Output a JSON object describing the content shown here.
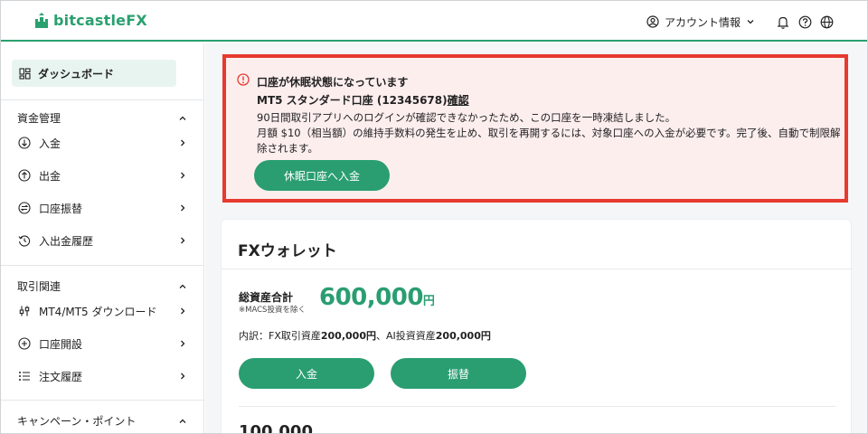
{
  "header": {
    "logo_text": "bitcastle",
    "logo_fx": "FX",
    "account_label": "アカウント情報"
  },
  "sidebar": {
    "dashboard": "ダッシュボード",
    "sections": [
      {
        "title": "資金管理",
        "items": [
          "入金",
          "出金",
          "口座振替",
          "入出金履歴"
        ]
      },
      {
        "title": "取引関連",
        "items": [
          "MT4/MT5 ダウンロード",
          "口座開設",
          "注文履歴"
        ]
      },
      {
        "title": "キャンペーン・ポイント",
        "items": []
      }
    ]
  },
  "alert": {
    "title": "口座が休眠状態になっています",
    "subtitle_prefix": "MT5 スタンダード口座 (12345678)",
    "subtitle_link": "確認",
    "line1": "90日間取引アプリへのログインが確認できなかったため、この口座を一時凍結しました。",
    "line2": "月額 $10（相当額）の維持手数料の発生を止め、取引を再開するには、対象口座への入金が必要です。完了後、自動で制限解除されます。",
    "button": "休眠口座へ入金"
  },
  "wallet": {
    "title": "FXウォレット",
    "total_label": "総資産合計",
    "total_note": "※MACS投資を除く",
    "total_value": "600,000",
    "total_unit": "円",
    "breakdown_prefix": "内訳：FX取引資産",
    "fx_amount": "200,000円",
    "breakdown_mid": "、AI投資資産",
    "ai_amount": "200,000円",
    "deposit_button": "入金",
    "transfer_button": "振替",
    "next_peek": "100,000"
  },
  "colors": {
    "brand": "#2aa06f",
    "alert_border": "#e63a2e",
    "alert_bg": "#fdeeee"
  }
}
